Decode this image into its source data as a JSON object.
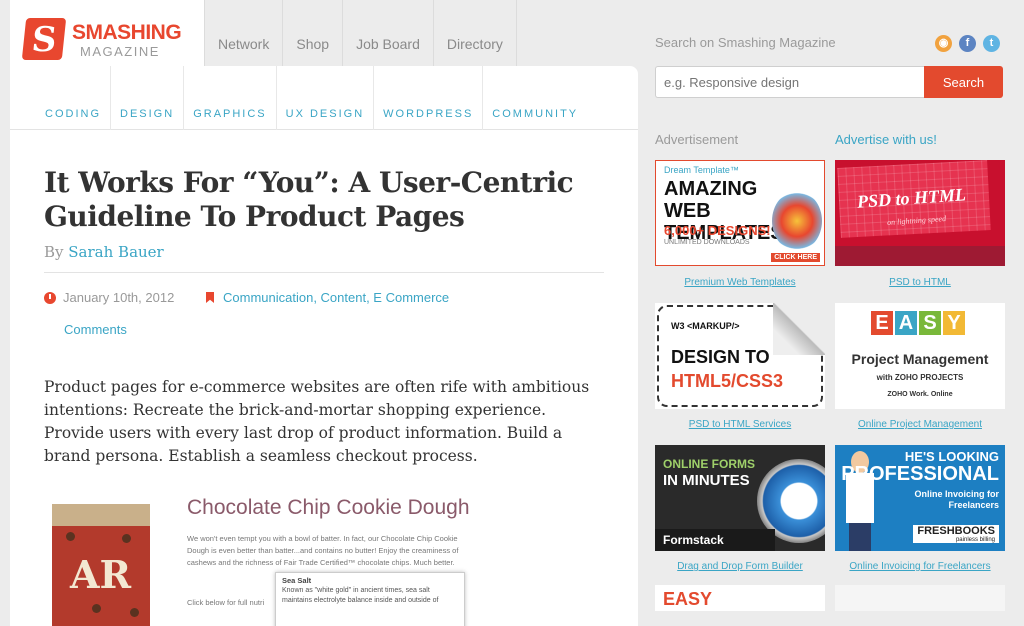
{
  "logo": {
    "word": "SMASHING",
    "sub": "MAGAZINE",
    "mark": "S"
  },
  "topnav": [
    "Network",
    "Shop",
    "Job Board",
    "Directory"
  ],
  "categories": [
    "CODING",
    "DESIGN",
    "GRAPHICS",
    "UX DESIGN",
    "WORDPRESS",
    "COMMUNITY"
  ],
  "article": {
    "title": "It Works For “You”: A User-Centric Guideline To Product Pages",
    "by": "By",
    "author": "Sarah Bauer",
    "date": "January 10th, 2012",
    "tags": "Communication, Content, E Commerce",
    "comments": "Comments",
    "intro": "Product pages for e-commerce websites are often rife with ambitious intentions: Recreate the brick-and-mortar shopping experience. Provide users with every last drop of product information. Build a brand persona. Establish a seamless checkout process."
  },
  "product": {
    "name": "Chocolate Chip Cookie Dough",
    "pack_label": "AR",
    "description": "We won't even tempt you with a bowl of batter. In fact, our Chocolate Chip Cookie Dough is even better than batter...and contains no butter! Enjoy the creaminess of cashews and the richness of Fair Trade Certified™ chocolate chips. Much better.",
    "note": "Click below for full nutri",
    "tooltip_title": "Sea Salt",
    "tooltip_text": "Known as \"white gold\" in ancient times, sea salt maintains electrolyte balance inside and outside of"
  },
  "sidebar": {
    "search_label": "Search on Smashing Magazine",
    "search_placeholder": "e.g. Responsive design",
    "search_button": "Search",
    "social": {
      "rss": "◉",
      "facebook": "f",
      "twitter": "t"
    },
    "ad_label": "Advertisement",
    "advertise_link": "Advertise with us!",
    "ads": [
      {
        "caption": "Premium Web Templates",
        "line1": "Dream Template™",
        "line2": "AMAZING WEB TEMPLATES",
        "line3": "6,000+ DESIGNS!",
        "line4": "UNLIMITED DOWNLOADS",
        "cta": "CLICK HERE"
      },
      {
        "caption": "PSD to HTML",
        "line1": "PSD to HTML",
        "line2": "on lightning speed"
      },
      {
        "caption": "PSD to HTML Services",
        "line1": "W3 <MARKUP/>",
        "line2": "DESIGN TO",
        "line3": "HTML5/CSS3"
      },
      {
        "caption": "Online Project Management",
        "letters": [
          "E",
          "A",
          "S",
          "Y"
        ],
        "line1": "Project Management",
        "line2": "with ZOHO PROJECTS",
        "line3": "ZOHO Work. Online"
      },
      {
        "caption": "Drag and Drop Form Builder",
        "line1": "ONLINE FORMS",
        "line2": "IN MINUTES",
        "line3": "Formstack"
      },
      {
        "caption": "Online Invoicing for Freelancers",
        "line1": "HE'S LOOKING",
        "line2": "PROFESSIONAL",
        "line3": "Online Invoicing for Freelancers",
        "brand": "FRESHBOOKS",
        "brand_sub": "painless billing"
      },
      {
        "line1": "EASY"
      }
    ]
  },
  "colors": {
    "accent": "#e34a2e",
    "link": "#3aa5c5",
    "text": "#333333"
  }
}
